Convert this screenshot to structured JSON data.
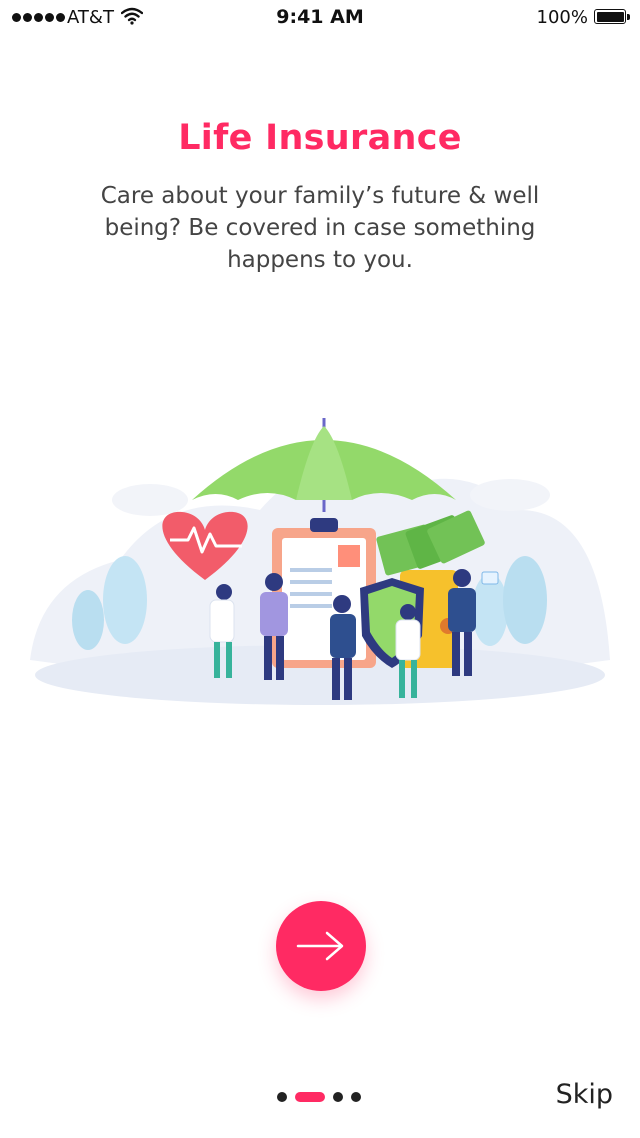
{
  "status_bar": {
    "carrier": "AT&T",
    "time": "9:41 AM",
    "battery_percent": "100%",
    "battery_level": 1.0,
    "signal_bars": 5
  },
  "onboarding": {
    "title": "Life Insurance",
    "description": "Care about your family’s future & well being? Be covered in case something happens to you.",
    "illustration": "insurance-umbrella-illustration",
    "next_icon": "arrow-right-icon",
    "page_count": 4,
    "current_page": 2,
    "skip_label": "Skip"
  },
  "colors": {
    "accent": "#ff2a63",
    "umbrella": "#93d96a",
    "heart": "#f25c6a",
    "text": "#444444",
    "dot": "#222222"
  }
}
